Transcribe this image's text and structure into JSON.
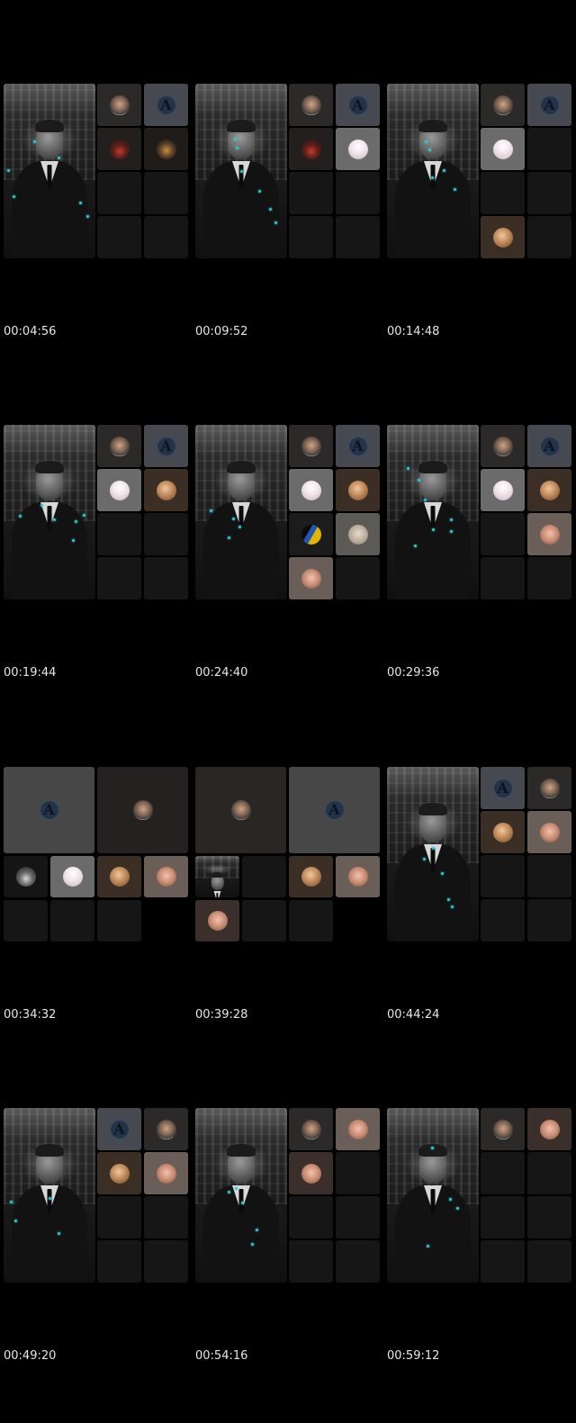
{
  "timestamps": [
    "00:04:56",
    "00:09:52",
    "00:14:48",
    "00:19:44",
    "00:24:40",
    "00:29:36",
    "00:34:32",
    "00:39:28",
    "00:44:24",
    "00:49:20",
    "00:54:16",
    "00:59:12"
  ],
  "avatar_letter": "A",
  "colors": {
    "background": "#000000",
    "empty_tile": "#161616",
    "speaking_tile": "#3a3a3a",
    "cyan_dot": "#2ec6d3"
  }
}
